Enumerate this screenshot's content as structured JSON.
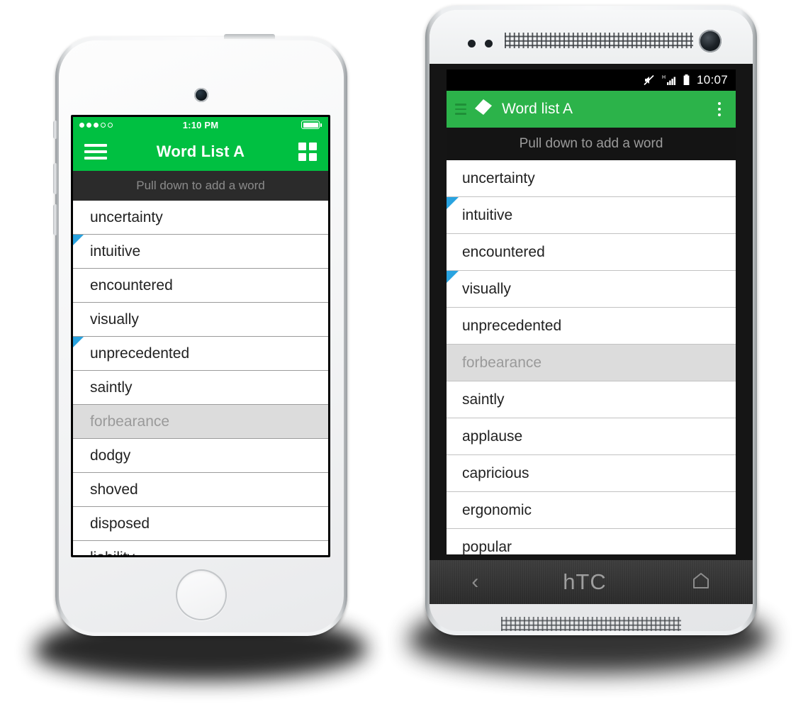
{
  "colors": {
    "ios_green": "#00c041",
    "android_green": "#2cb34a",
    "marker_blue": "#29a3e0",
    "dim_row_bg": "#dcdcdc",
    "dim_row_text": "#9a9a9a",
    "dark_bar": "#2b2b2b"
  },
  "ios": {
    "device_name": "iPhone",
    "status_bar": {
      "signal_dots_total": 5,
      "signal_dots_filled": 3,
      "time": "1:10 PM",
      "battery_icon": "battery-full-icon"
    },
    "nav_bar": {
      "menu_icon": "hamburger-menu-icon",
      "title": "Word List A",
      "grid_icon": "grid-view-icon"
    },
    "pull_hint": "Pull down to add a word",
    "words": [
      {
        "label": "uncertainty",
        "marked": false,
        "dim": false
      },
      {
        "label": "intuitive",
        "marked": true,
        "dim": false
      },
      {
        "label": "encountered",
        "marked": false,
        "dim": false
      },
      {
        "label": "visually",
        "marked": false,
        "dim": false
      },
      {
        "label": "unprecedented",
        "marked": true,
        "dim": false
      },
      {
        "label": "saintly",
        "marked": false,
        "dim": false
      },
      {
        "label": "forbearance",
        "marked": false,
        "dim": true
      },
      {
        "label": "dodgy",
        "marked": false,
        "dim": false
      },
      {
        "label": "shoved",
        "marked": false,
        "dim": false
      },
      {
        "label": "disposed",
        "marked": false,
        "dim": false
      },
      {
        "label": "liability",
        "marked": false,
        "dim": false
      }
    ],
    "hardware": {
      "camera": "front-camera",
      "sensor": "proximity-sensor",
      "speaker": "earpiece-speaker",
      "home_button": "home-button"
    }
  },
  "android": {
    "device_name": "HTC One",
    "status_bar": {
      "mute_icon": "mute-icon",
      "signal_icon": "signal-h-icon",
      "battery_icon": "battery-icon",
      "time": "10:07"
    },
    "action_bar": {
      "menu_icon": "hamburger-menu-icon",
      "logo_icon": "tag-logo-icon",
      "title": "Word list A",
      "overflow_icon": "overflow-menu-icon"
    },
    "pull_hint": "Pull down to add a word",
    "words": [
      {
        "label": "uncertainty",
        "marked": false,
        "dim": false
      },
      {
        "label": "intuitive",
        "marked": true,
        "dim": false
      },
      {
        "label": "encountered",
        "marked": false,
        "dim": false
      },
      {
        "label": "visually",
        "marked": true,
        "dim": false
      },
      {
        "label": "unprecedented",
        "marked": false,
        "dim": false
      },
      {
        "label": "forbearance",
        "marked": false,
        "dim": true
      },
      {
        "label": "saintly",
        "marked": false,
        "dim": false
      },
      {
        "label": "applause",
        "marked": false,
        "dim": false
      },
      {
        "label": "capricious",
        "marked": false,
        "dim": false
      },
      {
        "label": "ergonomic",
        "marked": false,
        "dim": false
      },
      {
        "label": "popular",
        "marked": false,
        "dim": false
      }
    ],
    "nav_bar": {
      "back_label": "‹",
      "brand": "hTC",
      "home_icon": "home-icon"
    },
    "hardware": {
      "speaker": "earpiece-speaker",
      "camera": "front-camera",
      "sensors": "proximity-sensors",
      "bottom_speaker": "bottom-speaker"
    }
  }
}
